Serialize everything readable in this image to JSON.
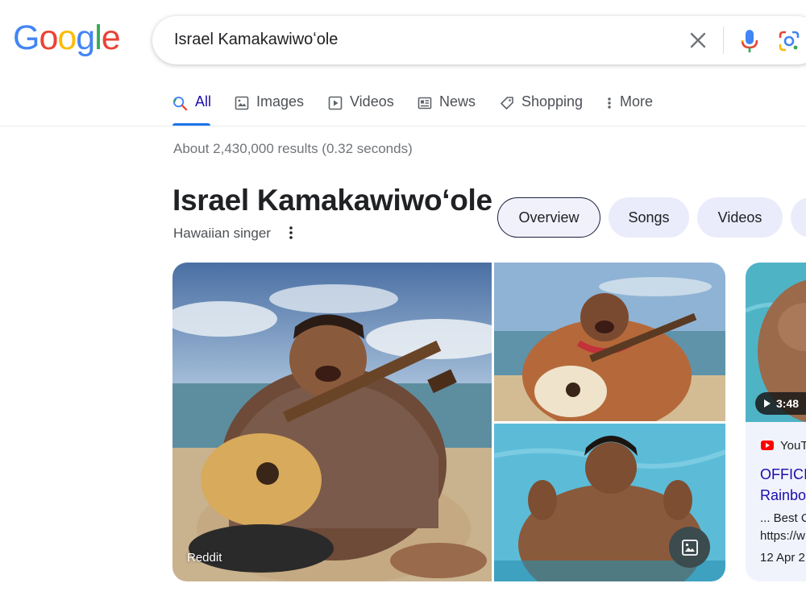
{
  "logo": {
    "letters": [
      "G",
      "o",
      "o",
      "g",
      "l",
      "e"
    ],
    "colors": [
      "#4285F4",
      "#EA4335",
      "#FBBC05",
      "#4285F4",
      "#34A853",
      "#EA4335"
    ]
  },
  "search": {
    "query": "Israel Kamakawiwoʻole"
  },
  "tabs": [
    {
      "label": "All",
      "icon": "search-icon",
      "active": true
    },
    {
      "label": "Images",
      "icon": "image-icon"
    },
    {
      "label": "Videos",
      "icon": "play-icon"
    },
    {
      "label": "News",
      "icon": "news-icon"
    },
    {
      "label": "Shopping",
      "icon": "tag-icon"
    },
    {
      "label": "More",
      "icon": "more-vert-icon"
    }
  ],
  "result_stats": "About 2,430,000 results (0.32 seconds)",
  "knowledge": {
    "title": "Israel Kamakawiwoʻole",
    "subtitle": "Hawaiian singer",
    "chips": [
      "Overview",
      "Songs",
      "Videos"
    ]
  },
  "images": {
    "source_label": "Reddit"
  },
  "video": {
    "duration": "3:48",
    "source": "YouT",
    "title": "OFFICIA Rainbow",
    "snippet": "... Best C https://w",
    "date": "12 Apr 2"
  },
  "colors": {
    "accent": "#1a73e8",
    "link": "#1a0dab",
    "chip_bg": "#eaecfb"
  }
}
